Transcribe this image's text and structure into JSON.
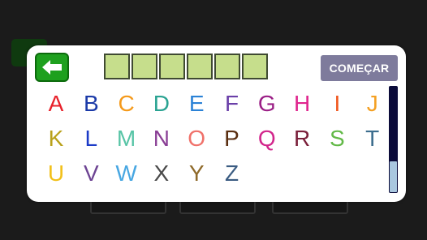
{
  "header": {
    "back_icon": "left-arrow-icon",
    "start_label": "COMEÇAR",
    "word_slots": 6
  },
  "keyboard": {
    "letters": [
      {
        "char": "A",
        "color": "#e8212b"
      },
      {
        "char": "B",
        "color": "#1b3aa8"
      },
      {
        "char": "C",
        "color": "#f59a1b"
      },
      {
        "char": "D",
        "color": "#2aa392"
      },
      {
        "char": "E",
        "color": "#2b82d6"
      },
      {
        "char": "F",
        "color": "#6a3fa8"
      },
      {
        "char": "G",
        "color": "#9b1f86"
      },
      {
        "char": "H",
        "color": "#e0258e"
      },
      {
        "char": "I",
        "color": "#f0571d"
      },
      {
        "char": "J",
        "color": "#f4a023"
      },
      {
        "char": "K",
        "color": "#b9a11a"
      },
      {
        "char": "L",
        "color": "#1c3bc7"
      },
      {
        "char": "M",
        "color": "#57c4a6"
      },
      {
        "char": "N",
        "color": "#8a3f95"
      },
      {
        "char": "O",
        "color": "#f0716a"
      },
      {
        "char": "P",
        "color": "#5a2e10"
      },
      {
        "char": "Q",
        "color": "#d2268c"
      },
      {
        "char": "R",
        "color": "#7a1f3a"
      },
      {
        "char": "S",
        "color": "#62b947"
      },
      {
        "char": "T",
        "color": "#3d6e8e"
      },
      {
        "char": "U",
        "color": "#f2c01a"
      },
      {
        "char": "V",
        "color": "#6d4393"
      },
      {
        "char": "W",
        "color": "#48a7e2"
      },
      {
        "char": "X",
        "color": "#4a4a4a"
      },
      {
        "char": "Y",
        "color": "#8f6a2a"
      },
      {
        "char": "Z",
        "color": "#3b5c82"
      }
    ]
  },
  "scrollbar": {
    "position": "bottom"
  }
}
